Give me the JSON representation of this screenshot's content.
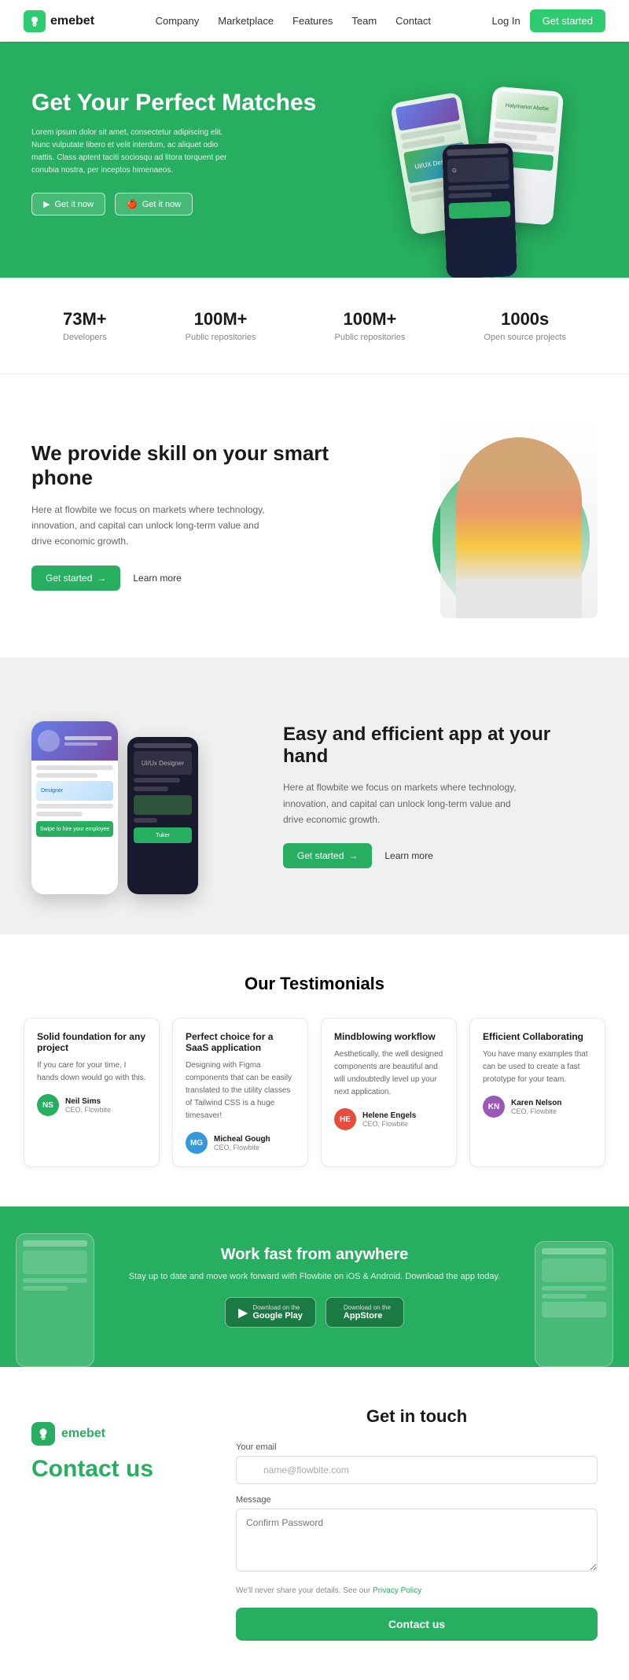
{
  "nav": {
    "logo": "emebet",
    "links": [
      "Company",
      "Marketplace",
      "Features",
      "Team",
      "Contact"
    ],
    "login_label": "Log In",
    "started_label": "Get started"
  },
  "hero": {
    "title": "Get Your Perfect Matches",
    "description": "Lorem ipsum dolor sit amet, consectetur adipiscing elit. Nunc vulputate libero et velit interdum, ac aliquet odio mattis. Class aptent taciti sociosqu ad litora torquent per conubia nostra, per inceptos himenaeos.",
    "btn_android": "Get it now",
    "btn_ios": "Get it now"
  },
  "stats": [
    {
      "number": "73M+",
      "label": "Developers"
    },
    {
      "number": "100M+",
      "label": "Public repositories"
    },
    {
      "number": "100M+",
      "label": "Public repositories"
    },
    {
      "number": "1000s",
      "label": "Open source projects"
    }
  ],
  "skill_section": {
    "title": "We provide skill on your smart phone",
    "description": "Here at flowbite we focus on markets where technology, innovation, and capital can unlock long-term value and drive economic growth.",
    "btn_started": "Get started",
    "btn_learn": "Learn more"
  },
  "app_section": {
    "title": "Easy and efficient app at your hand",
    "description": "Here at flowbite we focus on markets where technology, innovation, and capital can unlock long-term value and drive economic growth.",
    "btn_started": "Get started",
    "btn_learn": "Learn more"
  },
  "testimonials": {
    "title": "Our Testimonials",
    "cards": [
      {
        "title": "Solid foundation for any project",
        "text": "If you care for your time, I hands down would go with this.",
        "reviewer_name": "Neil Sims",
        "reviewer_role": "CEO, Flowbite",
        "avatar": "NS"
      },
      {
        "title": "Perfect choice for a SaaS application",
        "text": "Designing with Figma components that can be easily translated to the utility classes of Tailwind CSS is a huge timesaver!",
        "reviewer_name": "Micheal Gough",
        "reviewer_role": "CEO, Flowbite",
        "avatar": "MG"
      },
      {
        "title": "Mindblowing workflow",
        "text": "Aesthetically, the well designed components are beautiful and will undoubtedly level up your next application.",
        "reviewer_name": "Helene Engels",
        "reviewer_role": "CEO, Flowbite",
        "avatar": "HE"
      },
      {
        "title": "Efficient Collaborating",
        "text": "You have many examples that can be used to create a fast prototype for your team.",
        "reviewer_name": "Karen Nelson",
        "reviewer_role": "CEO, Flowbite",
        "avatar": "KN"
      }
    ]
  },
  "promo": {
    "title": "Work fast from anywhere",
    "description": "Stay up to date and move work forward with Flowbite on iOS & Android. Download the app today.",
    "btn_google_sub": "Download on the",
    "btn_google_main": "Google Play",
    "btn_apple_sub": "Download on the",
    "btn_apple_main": "AppStore"
  },
  "contact": {
    "section_title": "Get in touch",
    "logo": "emebet",
    "contact_us_label": "Contact us",
    "email_label": "Your email",
    "email_placeholder": "name@flowbite.com",
    "message_label": "Message",
    "message_placeholder": "Confirm Password",
    "privacy_note": "We'll never share your details. See our",
    "privacy_link": "Privacy Policy",
    "btn_label": "Contact us"
  }
}
